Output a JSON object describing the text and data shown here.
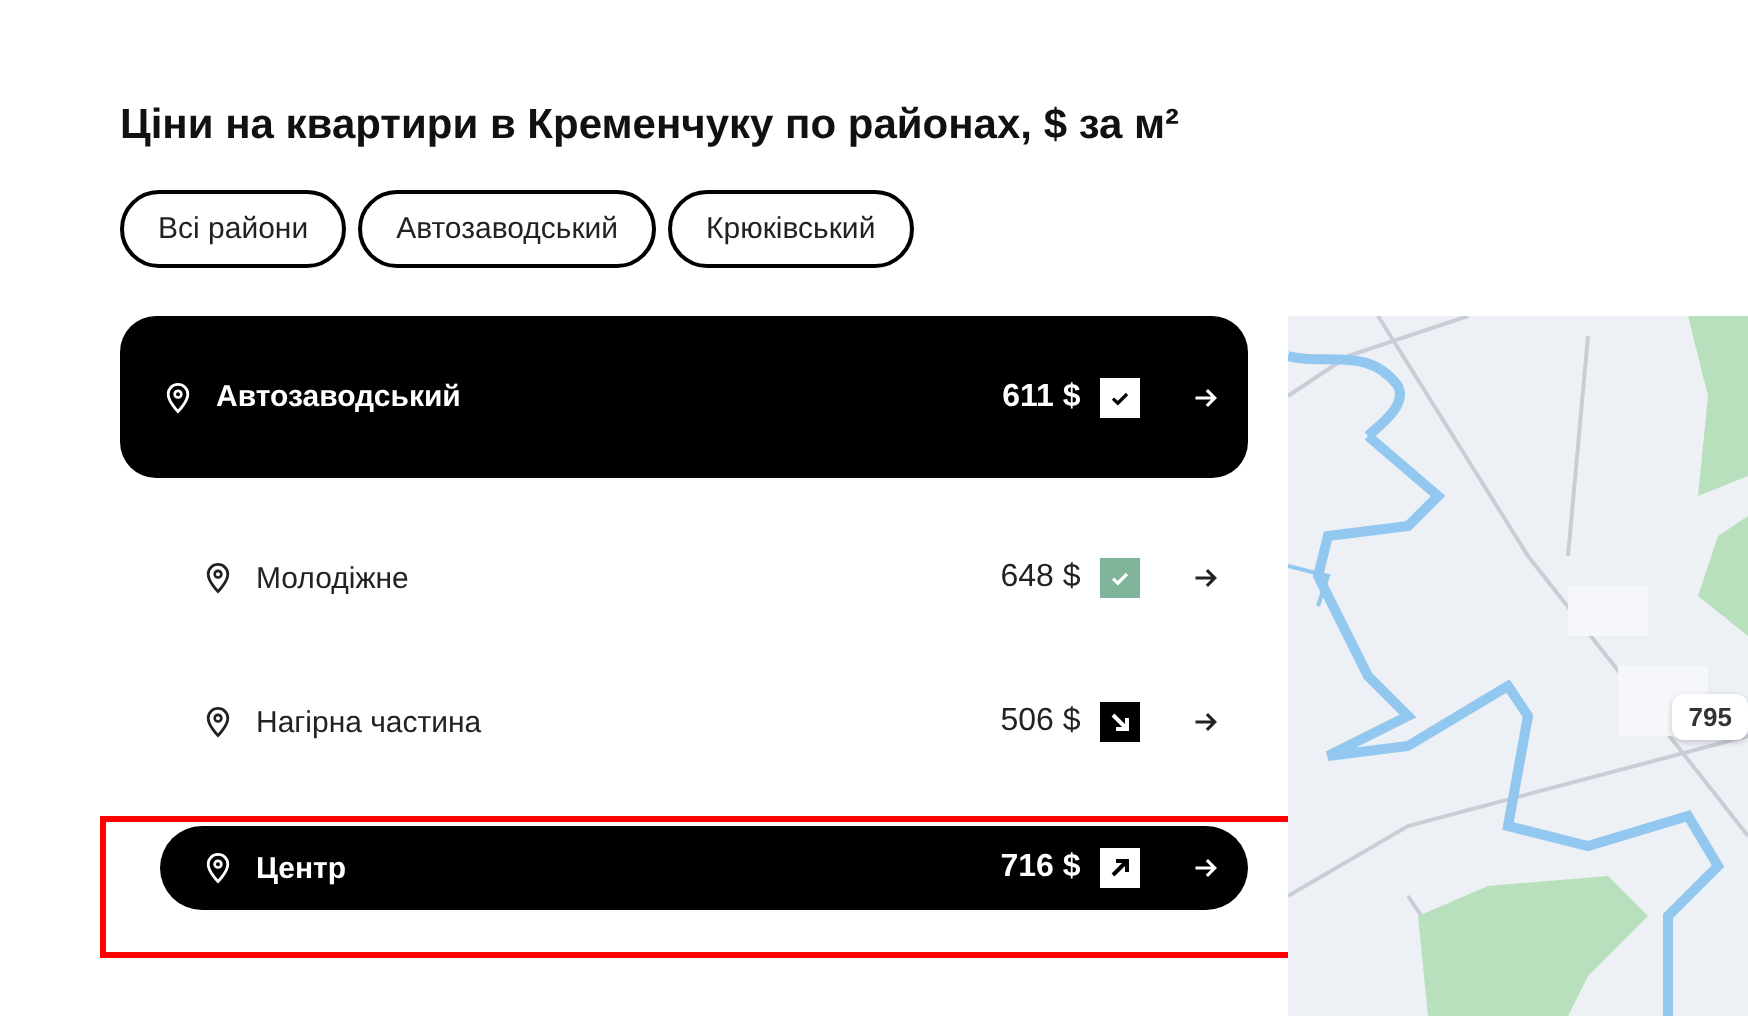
{
  "title": "Ціни на квартири в Кременчуку по районах, $ за м²",
  "filters": [
    {
      "label": "Всі райони"
    },
    {
      "label": "Автозаводський"
    },
    {
      "label": "Крюківський"
    }
  ],
  "district": {
    "name": "Автозаводський",
    "price": "611 $",
    "kind": "check",
    "selected": true,
    "children": [
      {
        "name": "Молодіжне",
        "price": "648 $",
        "kind": "check",
        "selected": false
      },
      {
        "name": "Нагірна частина",
        "price": "506 $",
        "kind": "down",
        "selected": false
      },
      {
        "name": "Центр",
        "price": "716 $",
        "kind": "up",
        "selected": true,
        "highlighted": true
      }
    ]
  },
  "map": {
    "kind": "picture",
    "marker": "795"
  }
}
